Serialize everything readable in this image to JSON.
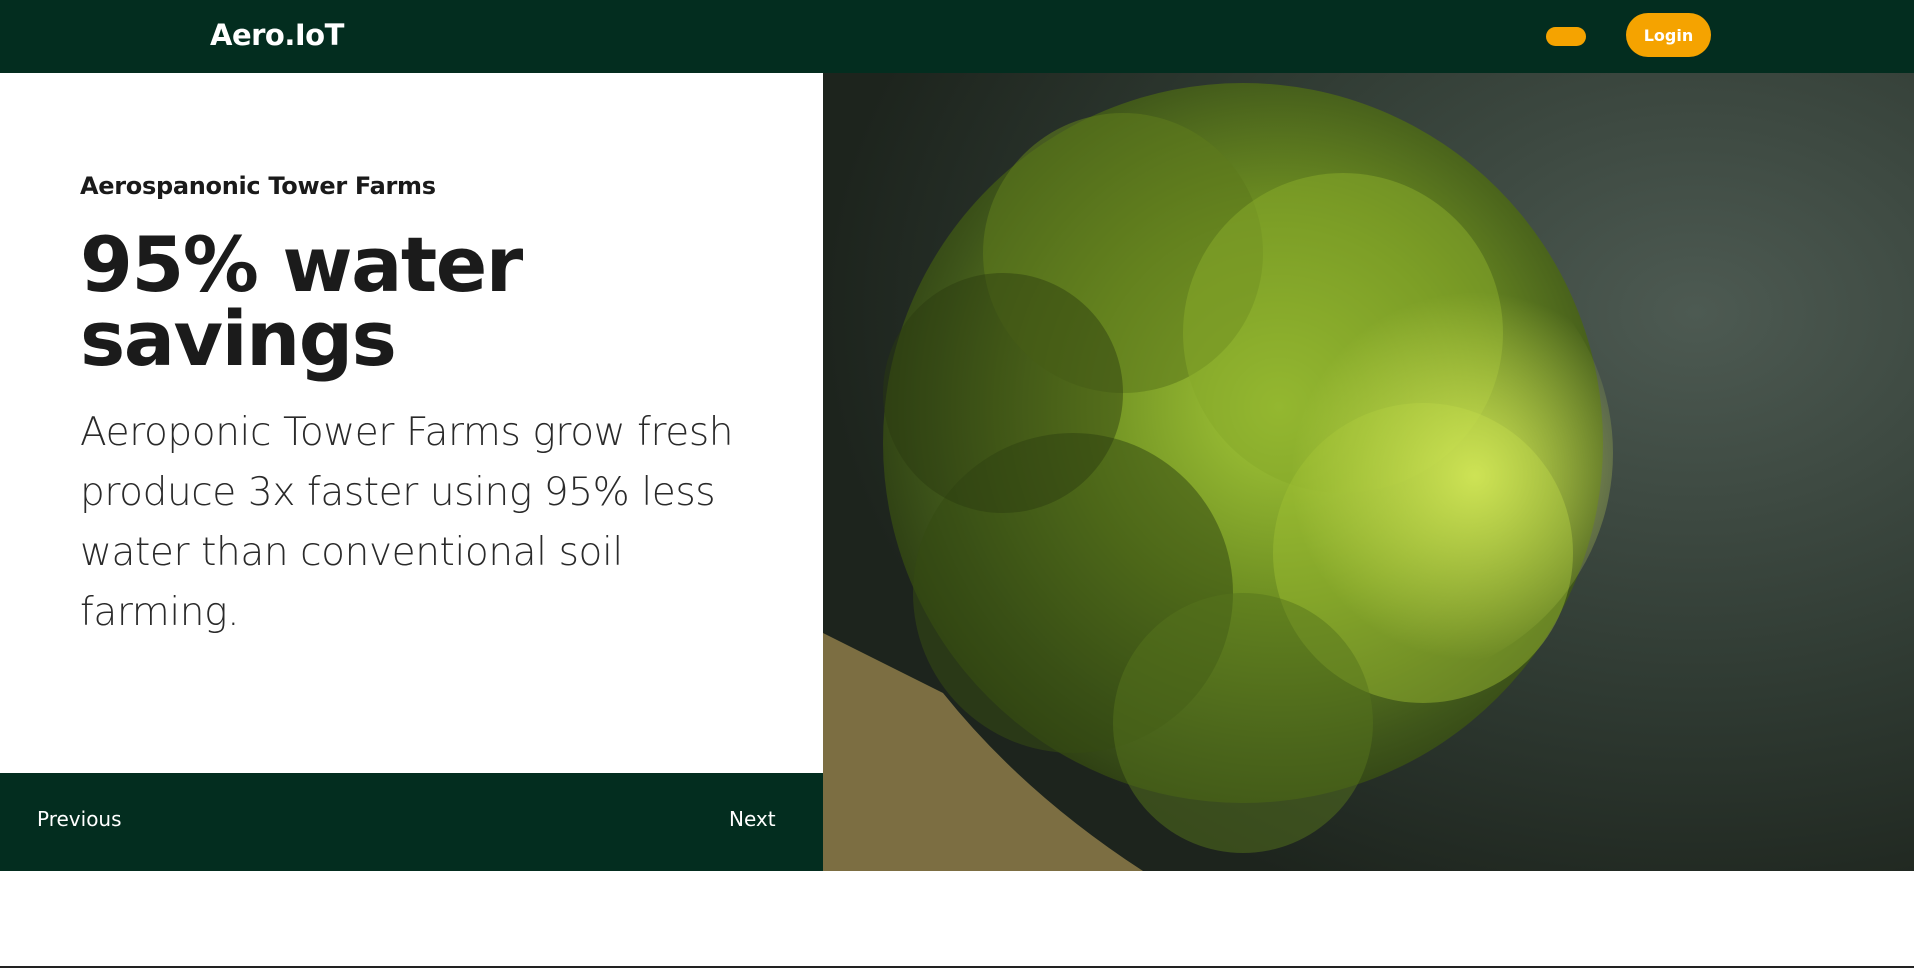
{
  "header": {
    "logo": "Aero.IoT",
    "login_label": "Login",
    "accent": "#f5a300",
    "bg": "#032d1f"
  },
  "hero": {
    "eyebrow": "Aerospanonic Tower Farms",
    "headline": "95% water savings",
    "body": "Aeroponic Tower Farms grow fresh produce 3x faster using 95% less water than conventional soil farming."
  },
  "carousel": {
    "prev_label": "Previous",
    "next_label": "Next"
  },
  "image": {
    "subject": "lettuce-photo"
  }
}
